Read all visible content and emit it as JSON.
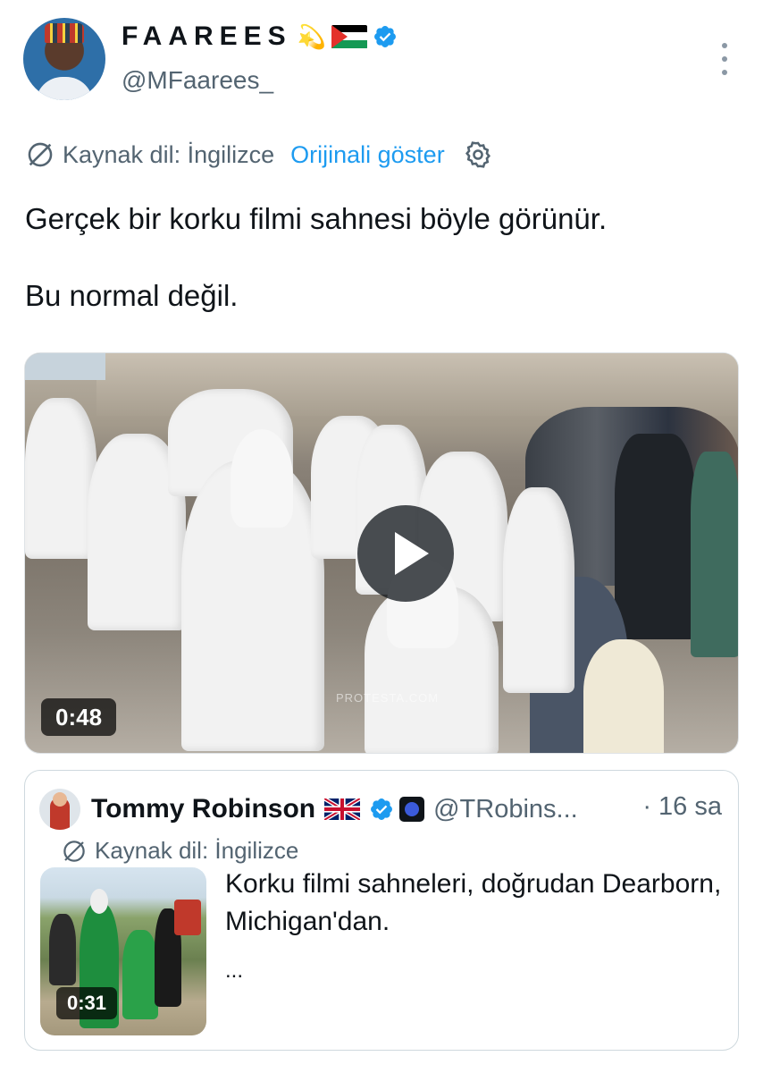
{
  "author": {
    "display_name": "FAAREES",
    "emoji_sparkle": "💫",
    "handle": "@MFaarees_"
  },
  "translation": {
    "source_lang": "Kaynak dil: İngilizce",
    "show_original": "Orijinali göster"
  },
  "tweet": {
    "line1": "Gerçek bir korku filmi sahnesi böyle görünür.",
    "line2": "Bu normal değil."
  },
  "media": {
    "duration": "0:48",
    "watermark": "PROTESTA.COM"
  },
  "quoted_tweet": {
    "display_name": "Tommy Robinson",
    "handle": "@TRobins...",
    "time": "· 16 sa",
    "source_lang": "Kaynak dil: İngilizce",
    "text": "Korku filmi sahneleri, doğrudan Dearborn, Michigan'dan.",
    "ellipsis": "...",
    "video_duration": "0:31"
  },
  "colors": {
    "link": "#1d9bf0",
    "secondary_text": "#536471",
    "verified": "#1d9bf0"
  }
}
